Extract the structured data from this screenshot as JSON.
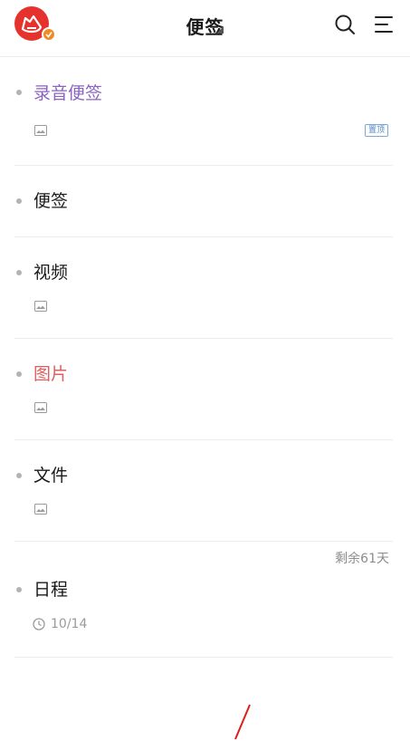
{
  "header": {
    "title": "便签",
    "icons": [
      "app-avatar-icon",
      "vip-badge-icon",
      "dropdown-caret-icon",
      "search-icon",
      "menu-icon"
    ],
    "colors": {
      "avatar": "#e5322d",
      "badge": "#f08a24"
    }
  },
  "notes": [
    {
      "title": "录音便签",
      "title_color": "#8a63c2",
      "has_image_icon": true,
      "pin_label": "置顶"
    },
    {
      "title": "便签",
      "title_color": "#1a1a1a",
      "has_image_icon": false
    },
    {
      "title": "视频",
      "title_color": "#1a1a1a",
      "has_image_icon": true
    },
    {
      "title": "图片",
      "title_color": "#e25d5d",
      "has_image_icon": true
    },
    {
      "title": "文件",
      "title_color": "#1a1a1a",
      "has_image_icon": true
    },
    {
      "title": "日程",
      "title_color": "#1a1a1a",
      "remaining": "剩余61天",
      "date": "10/14"
    }
  ]
}
